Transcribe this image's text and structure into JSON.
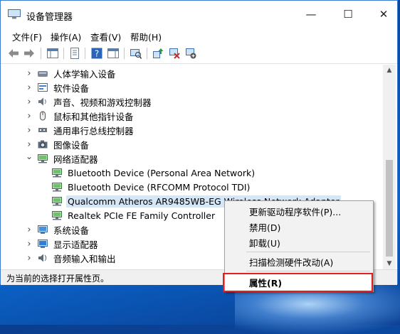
{
  "window": {
    "title": "设备管理器",
    "minimize_glyph": "—",
    "maximize_glyph": "☐",
    "close_glyph": "✕"
  },
  "menu": [
    "文件(F)",
    "操作(A)",
    "查看(V)",
    "帮助(H)"
  ],
  "tree_items": [
    {
      "label": "人体学输入设备",
      "expanded": false,
      "icon": "hid-icon"
    },
    {
      "label": "软件设备",
      "expanded": false,
      "icon": "software-device-icon"
    },
    {
      "label": "声音、视频和游戏控制器",
      "expanded": false,
      "icon": "speaker-icon"
    },
    {
      "label": "鼠标和其他指针设备",
      "expanded": false,
      "icon": "mouse-icon"
    },
    {
      "label": "通用串行总线控制器",
      "expanded": false,
      "icon": "usb-icon"
    },
    {
      "label": "图像设备",
      "expanded": false,
      "icon": "camera-icon"
    },
    {
      "label": "网络适配器",
      "expanded": true,
      "icon": "network-adapter-icon"
    },
    {
      "label": "Bluetooth Device (Personal Area Network)",
      "child": true,
      "icon": "network-adapter-icon"
    },
    {
      "label": "Bluetooth Device (RFCOMM Protocol TDI)",
      "child": true,
      "icon": "network-adapter-icon"
    },
    {
      "label": "Qualcomm Atheros AR9485WB-EG Wireless Network Adapter",
      "child": true,
      "selected": true,
      "icon": "network-adapter-icon"
    },
    {
      "label": "Realtek PCIe FE Family Controller",
      "child": true,
      "icon": "network-adapter-icon"
    },
    {
      "label": "系统设备",
      "expanded": false,
      "icon": "system-device-icon"
    },
    {
      "label": "显示适配器",
      "expanded": false,
      "icon": "display-adapter-icon"
    },
    {
      "label": "音频输入和输出",
      "expanded": false,
      "icon": "audio-io-icon"
    }
  ],
  "status": {
    "text": "为当前的选择打开属性页。"
  },
  "context_menu": {
    "update_driver": "更新驱动程序软件(P)...",
    "disable": "禁用(D)",
    "uninstall": "卸载(U)",
    "scan": "扫描检测硬件改动(A)",
    "properties": "属性(R)"
  },
  "colors": {
    "highlight_box": "#e02020",
    "selection": "#d5e6f7",
    "desktop": "#0a56b8"
  }
}
